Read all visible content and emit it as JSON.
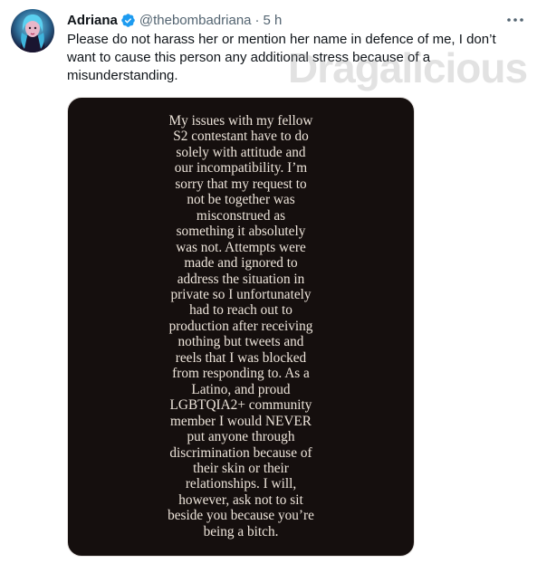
{
  "tweet": {
    "display_name": "Adriana",
    "handle": "@thebombadriana",
    "separator": "·",
    "time": "5 h",
    "text": "Please do not harass her or mention her name in defence of me, I don’t want to cause this person any additional stress because of a misunderstanding.",
    "watermark": "Dragalicious",
    "icons": {
      "verified": "verified-badge-icon",
      "more": "more-horizontal-icon"
    },
    "colors": {
      "verified": "#1d9bf0",
      "handle": "#536471",
      "media_background": "#150f0e",
      "media_text": "#ede4da"
    },
    "media_lines": [
      "My issues with my fellow",
      "S2 contestant have to do",
      "solely with attitude and",
      "our incompatibility. I’m",
      "sorry that my request to",
      "not be together was",
      "misconstrued as",
      "something it absolutely",
      "was not. Attempts were",
      "made and ignored to",
      "address the situation in",
      "private so I unfortunately",
      "had to reach out to",
      "production after receiving",
      "nothing but tweets and",
      "reels that I was blocked",
      "from responding to. As a",
      "Latino, and proud",
      "LGBTQIA2+ community",
      "member I would NEVER",
      "put anyone through",
      "discrimination because of",
      "their skin or their",
      "relationships. I will,",
      "however, ask not to sit",
      "beside you because you’re",
      "being a bitch."
    ]
  }
}
